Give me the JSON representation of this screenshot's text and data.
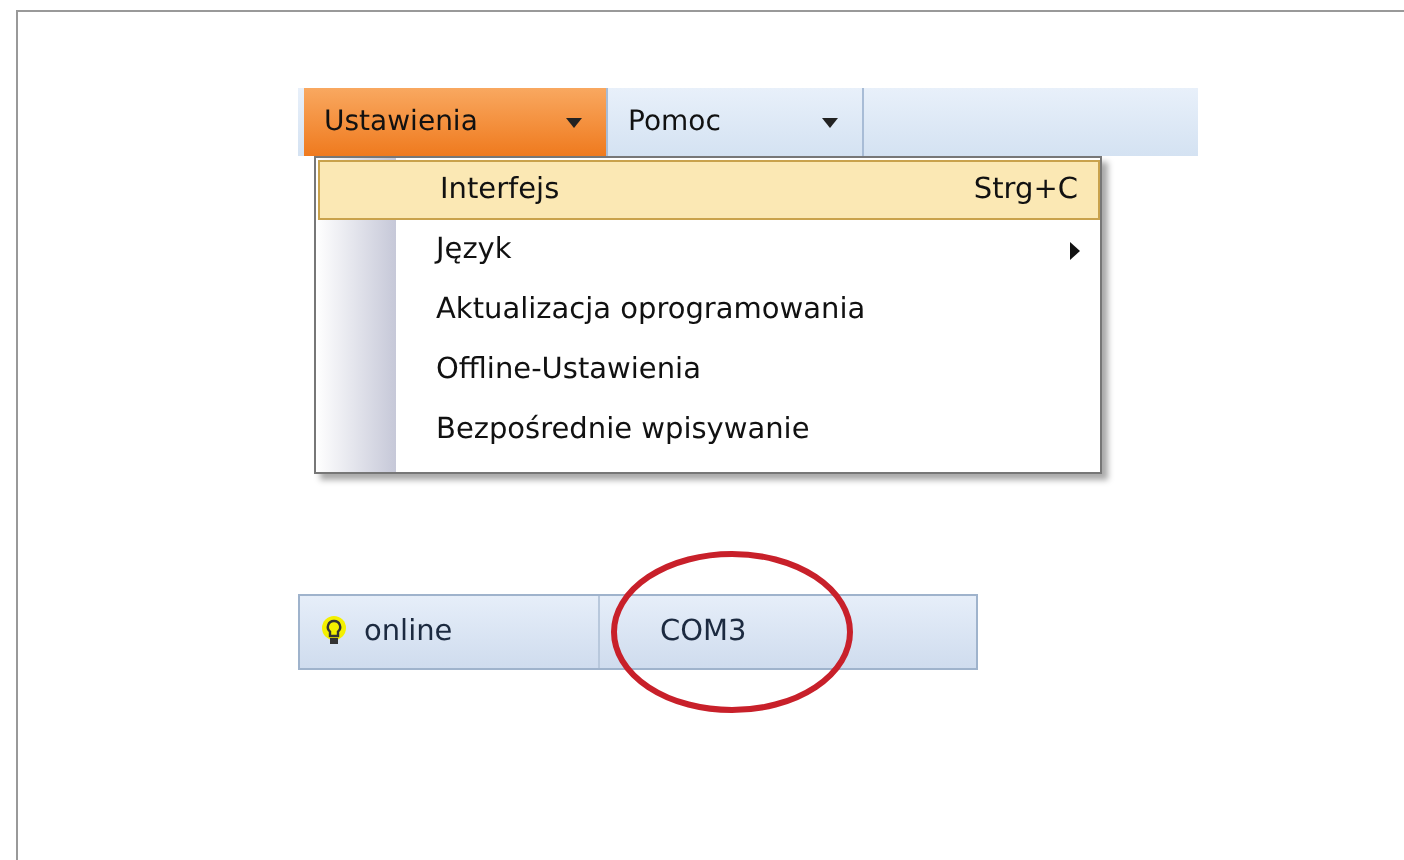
{
  "menu_bar": [
    {
      "label": "Ustawienia",
      "selected": true
    },
    {
      "label": "Pomoc",
      "selected": false
    }
  ],
  "dropdown": [
    {
      "label": "Interfejs",
      "shortcut": "Strg+C",
      "selected": true,
      "submenu": false
    },
    {
      "label": "Język",
      "selected": false,
      "submenu": true
    },
    {
      "label": "Aktualizacja oprogramowania",
      "selected": false,
      "submenu": false
    },
    {
      "label": "Offline-Ustawienia",
      "selected": false,
      "submenu": false
    },
    {
      "label": "Bezpośrednie wpisywanie",
      "selected": false,
      "submenu": false
    }
  ],
  "status_bar": [
    {
      "kind": "status",
      "text": "online"
    },
    {
      "kind": "port",
      "text": "COM3",
      "circled": true
    }
  ]
}
